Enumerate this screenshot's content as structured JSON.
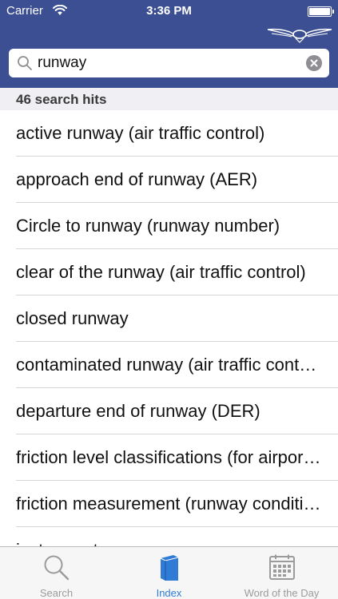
{
  "status_bar": {
    "carrier": "Carrier",
    "time": "3:36 PM"
  },
  "search": {
    "value": "runway"
  },
  "results": {
    "hits_label": "46 search hits",
    "items": [
      "active runway (air traffic control)",
      "approach end of runway (AER)",
      "Circle to runway (runway number)",
      "clear of the runway (air traffic control)",
      "closed runway",
      "contaminated runway (air traffic control)",
      "departure end of runway (DER)",
      "friction level classifications (for airports)",
      "friction measurement (runway condition)",
      "instrument runway"
    ]
  },
  "tabs": [
    {
      "label": "Search",
      "icon": "magnifier-icon",
      "active": false
    },
    {
      "label": "Index",
      "icon": "book-icon",
      "active": true
    },
    {
      "label": "Word of the Day",
      "icon": "calendar-icon",
      "active": false
    }
  ],
  "colors": {
    "nav_bar": "#3c4f92",
    "tab_active": "#2f7bd6",
    "tab_inactive": "#9b9b9b"
  }
}
